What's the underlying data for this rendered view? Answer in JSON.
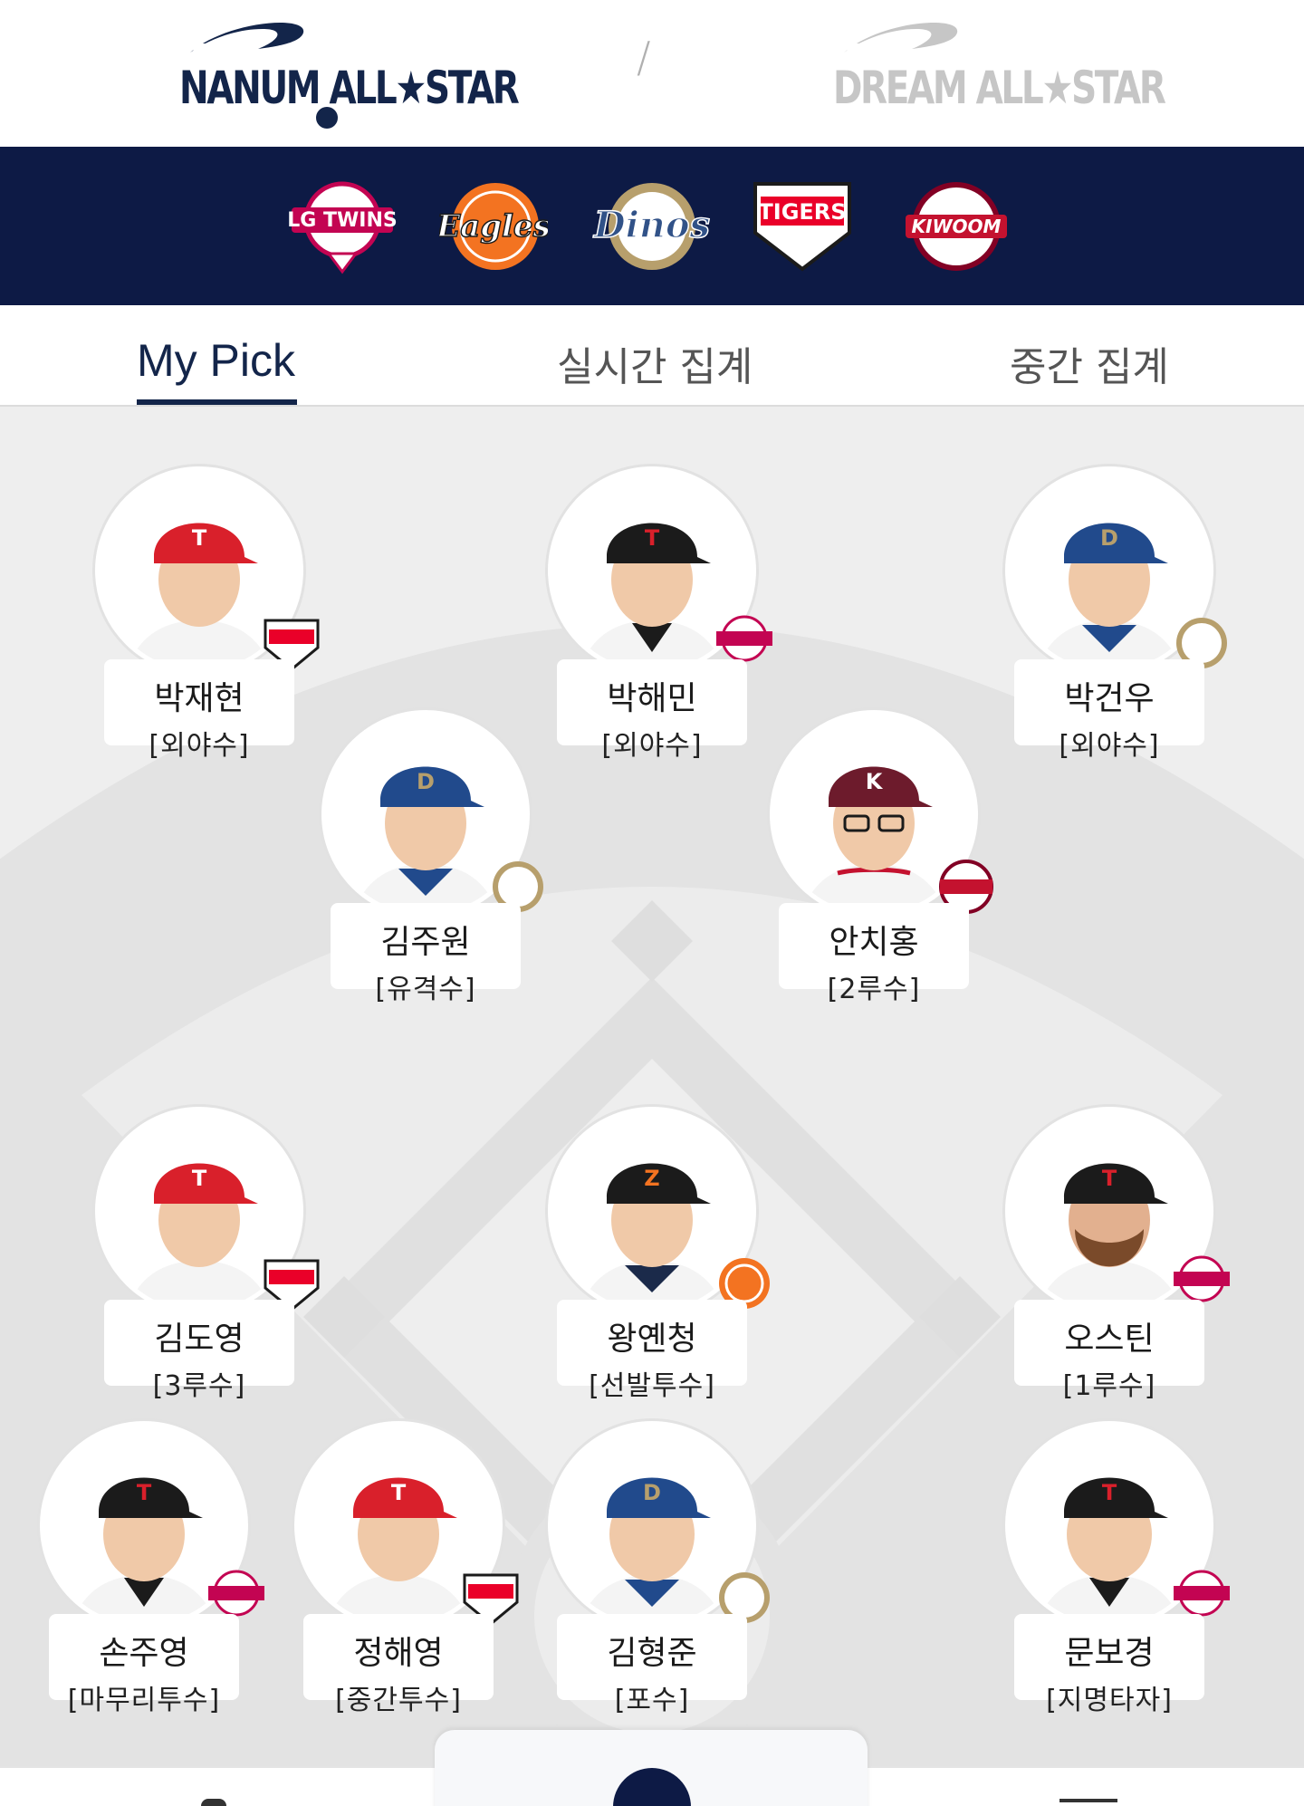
{
  "header": {
    "nanum_logo_text": "NANUM ALL★STAR",
    "dream_logo_text": "DREAM ALL★STAR",
    "separator": "/"
  },
  "teams": [
    {
      "name": "LG TWINS",
      "icon": "lg-twins-logo",
      "color": "#c30452"
    },
    {
      "name": "Eagles",
      "icon": "hanwha-eagles-logo",
      "color": "#f37321"
    },
    {
      "name": "Dinos",
      "icon": "nc-dinos-logo",
      "color": "#315288"
    },
    {
      "name": "TIGERS",
      "icon": "kia-tigers-logo",
      "color": "#ea0029"
    },
    {
      "name": "KIWOOM",
      "icon": "kiwoom-heroes-logo",
      "color": "#820024"
    }
  ],
  "tabs": [
    {
      "label": "My Pick",
      "active": true
    },
    {
      "label": "실시간 집계",
      "active": false
    },
    {
      "label": "중간 집계",
      "active": false
    }
  ],
  "players": [
    {
      "name": "박재현",
      "position": "[외야수]",
      "team": "TIGERS",
      "cap": "#d9202b"
    },
    {
      "name": "박해민",
      "position": "[외야수]",
      "team": "TWINS",
      "cap": "#1b1b1b"
    },
    {
      "name": "박건우",
      "position": "[외야수]",
      "team": "Dinos",
      "cap": "#214a8c"
    },
    {
      "name": "김주원",
      "position": "[유격수]",
      "team": "Dinos",
      "cap": "#214a8c"
    },
    {
      "name": "안치홍",
      "position": "[2루수]",
      "team": "KIWOOM",
      "cap": "#6d1b2c"
    },
    {
      "name": "김도영",
      "position": "[3루수]",
      "team": "TIGERS",
      "cap": "#d9202b"
    },
    {
      "name": "왕옌청",
      "position": "[선발투수]",
      "team": "Eagles",
      "cap": "#1b1b1b"
    },
    {
      "name": "오스틴",
      "position": "[1루수]",
      "team": "TWINS",
      "cap": "#1b1b1b"
    },
    {
      "name": "손주영",
      "position": "[마무리투수]",
      "team": "TWINS",
      "cap": "#1b1b1b"
    },
    {
      "name": "정해영",
      "position": "[중간투수]",
      "team": "TIGERS",
      "cap": "#d9202b"
    },
    {
      "name": "김형준",
      "position": "[포수]",
      "team": "Dinos",
      "cap": "#214a8c"
    },
    {
      "name": "문보경",
      "position": "[지명타자]",
      "team": "TWINS",
      "cap": "#1b1b1b"
    }
  ],
  "colors": {
    "navy": "#0d1a45",
    "field_bg": "#eeeeee",
    "field_lines": "#dedede"
  }
}
